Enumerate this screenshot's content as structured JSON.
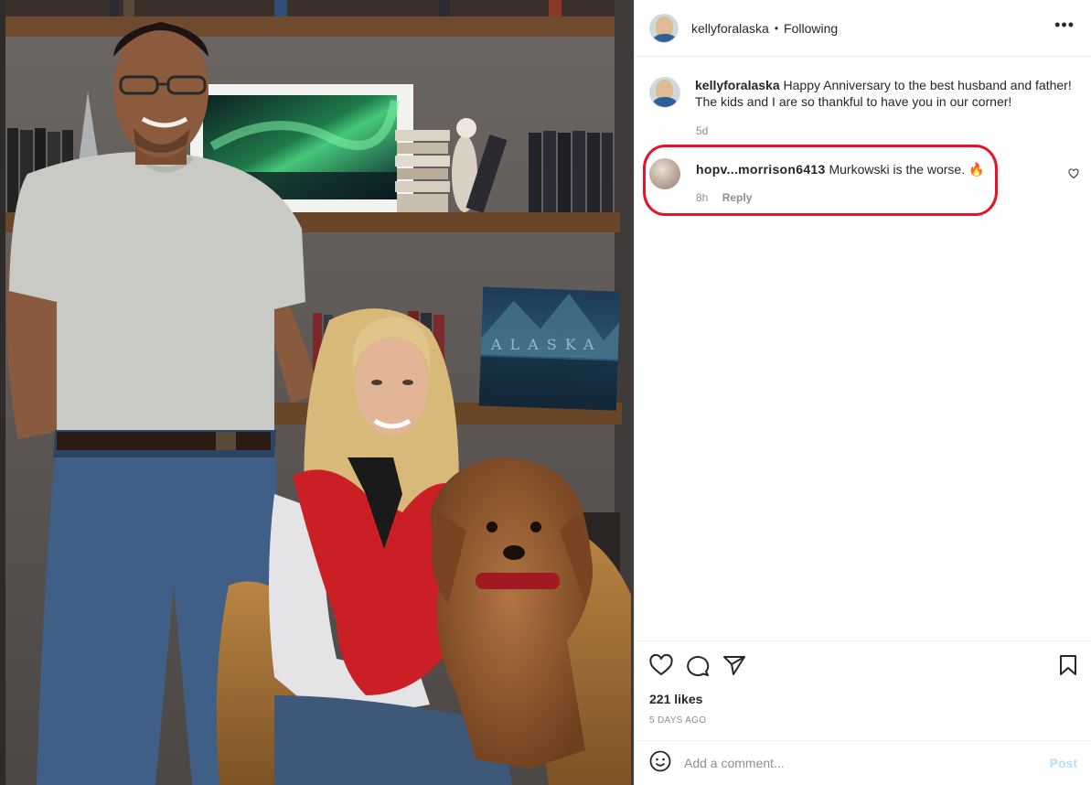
{
  "post": {
    "author": "kellyforalaska",
    "follow_separator": "•",
    "follow_status": "Following",
    "more_icon": "more-horizontal-icon",
    "more_label": "•••",
    "photo_book_title": "ALASKA"
  },
  "caption": {
    "username": "kellyforalaska",
    "text": "Happy Anniversary to the best husband and father! The kids and I are so thankful to have you in our corner!",
    "time": "5d"
  },
  "comments": [
    {
      "username": "hopv...morrison6413",
      "text": "Murkowski is the worse.",
      "emoji": "🔥",
      "time": "8h",
      "reply_label": "Reply",
      "highlight_color": "#e3142a"
    }
  ],
  "actions": {
    "icons": [
      "heart-icon",
      "comment-icon",
      "share-icon",
      "bookmark-icon"
    ],
    "likes": "221 likes",
    "posted_ago": "5 DAYS AGO"
  },
  "add_comment": {
    "placeholder": "Add a comment...",
    "post_label": "Post",
    "post_color": "#b2dffc"
  }
}
